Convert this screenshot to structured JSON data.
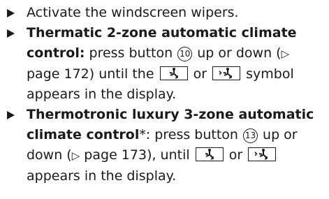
{
  "steps": [
    {
      "text": "Activate the windscreen wipers."
    },
    {
      "bold": "Thermatic 2-zone automatic climate control:",
      "p1": " press button ",
      "button": "10",
      "p2": " up or down (",
      "ref_arrow": "▷",
      "ref": " page 172) until the ",
      "p3": " or ",
      "p4": " symbol appears in the display."
    },
    {
      "bold": "Thermotronic luxury 3-zone automatic climate control",
      "star_colon": "*:",
      "p1": " press button ",
      "button": "13",
      "p2": " up or down (",
      "ref_arrow": "▷",
      "ref": " page 173), until ",
      "p3": " or ",
      "p4": " appears in the display."
    }
  ],
  "icons": {
    "symbol_a": "airflow-footwell-icon",
    "symbol_b": "airflow-windscreen-footwell-icon"
  }
}
